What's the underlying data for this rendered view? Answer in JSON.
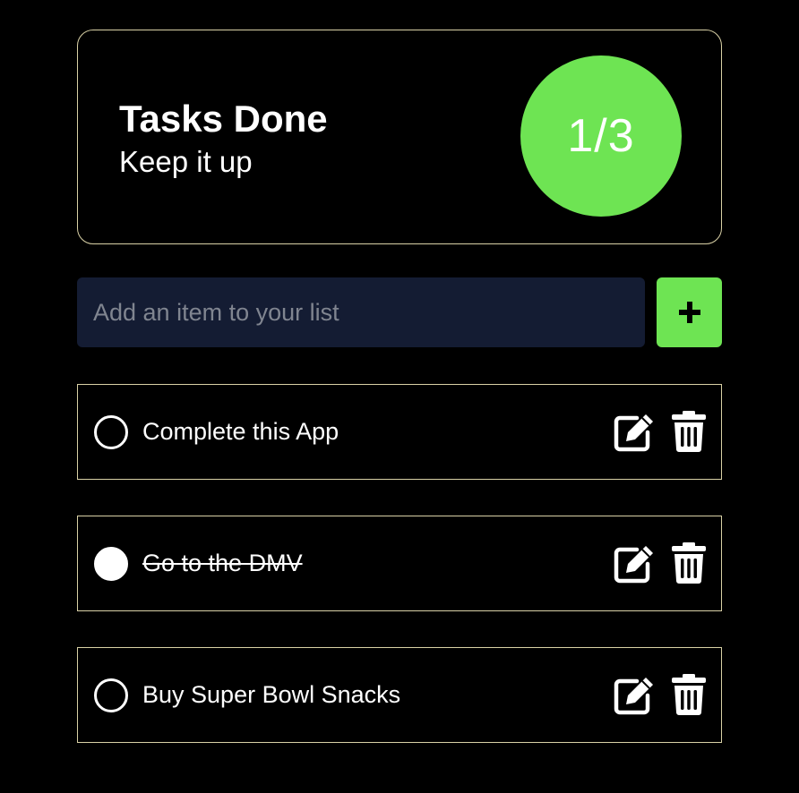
{
  "summary": {
    "title": "Tasks Done",
    "subtitle": "Keep it up",
    "progress": "1/3",
    "progress_color": "#6ee453"
  },
  "add_item": {
    "placeholder": "Add an item to your list",
    "value": "",
    "button_icon": "plus-icon"
  },
  "tasks": [
    {
      "label": "Complete this App",
      "done": false,
      "edit_icon": "edit-icon",
      "delete_icon": "trash-icon"
    },
    {
      "label": "Go to the DMV",
      "done": true,
      "edit_icon": "edit-icon",
      "delete_icon": "trash-icon"
    },
    {
      "label": "Buy Super Bowl Snacks",
      "done": false,
      "edit_icon": "edit-icon",
      "delete_icon": "trash-icon"
    }
  ]
}
